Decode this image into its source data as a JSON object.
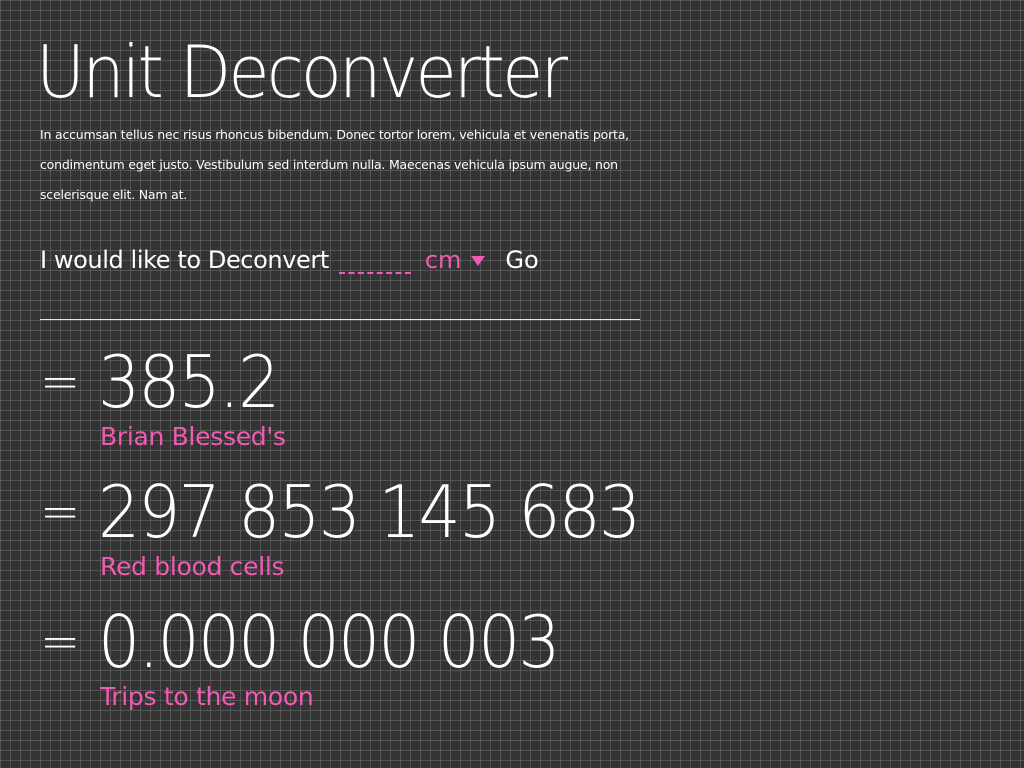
{
  "title": "Unit Deconverter",
  "intro": "In accumsan tellus nec risus rhoncus bibendum. Donec tortor lorem, vehicula et venenatis porta, condimentum eget justo. Vestibulum sed interdum nulla. Maecenas vehicula ipsum augue, non scelerisque elit. Nam at.",
  "converter": {
    "prompt": "I would like to Deconvert",
    "input_value": "",
    "input_placeholder": "",
    "unit": "cm",
    "unit_icon": "caret-down-icon",
    "go_label": "Go"
  },
  "results": [
    {
      "equals": "=",
      "number": "385.2",
      "label": "Brian Blessed's"
    },
    {
      "equals": "=",
      "number": "297 853 145 683",
      "label": "Red blood cells"
    },
    {
      "equals": "=",
      "number": "0.000 000 003",
      "label": "Trips to the moon"
    }
  ],
  "colors": {
    "background": "#333333",
    "grid": "#6e6e6e",
    "accent": "#f25ab4",
    "text": "#ffffff"
  }
}
